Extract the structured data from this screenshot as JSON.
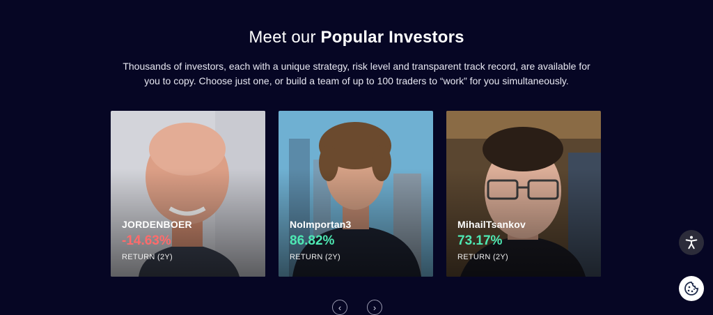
{
  "section": {
    "title_light": "Meet our ",
    "title_bold": "Popular Investors",
    "subtitle_line1": "Thousands of investors, each with a unique strategy, risk level and transparent track record, are available for",
    "subtitle_line2": "you to copy. Choose just one, or build a team of up to 100 traders to “work” for you simultaneously."
  },
  "investors": [
    {
      "name": "JORDENBOER",
      "return": "-14.63%",
      "return_label": "RETURN (2Y)",
      "return_color": "#ff6b6b"
    },
    {
      "name": "NoImportan3",
      "return": "86.82%",
      "return_label": "RETURN (2Y)",
      "return_color": "#4ee8b3"
    },
    {
      "name": "MihailTsankov",
      "return": "73.17%",
      "return_label": "RETURN (2Y)",
      "return_color": "#4ee8b3"
    }
  ],
  "carousel": {
    "prev_icon": "chevron-left-icon",
    "next_icon": "chevron-right-icon"
  },
  "floating": {
    "accessibility_icon": "accessibility-icon",
    "cookie_icon": "cookie-icon"
  },
  "colors": {
    "background": "#060624",
    "negative": "#ff6b6b",
    "positive": "#4ee8b3"
  }
}
